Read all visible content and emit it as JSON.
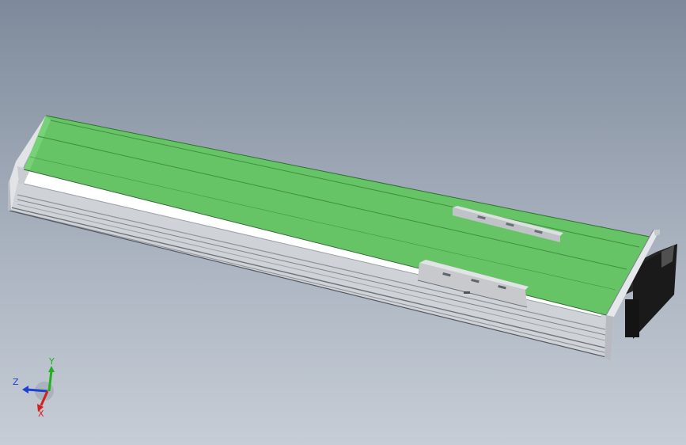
{
  "viewport": {
    "background_top": "#7e8a9b",
    "background_bottom": "#c6cdd6"
  },
  "model": {
    "belt_cover_color": "#66c466",
    "frame_color": "#d4d6da",
    "rail_shadow_color": "#8e939b",
    "motor_color": "#1e1e1e",
    "end_plate_color": "#e6e7ea",
    "carriage_color": "#c7c9cd"
  },
  "triad": {
    "x_label": "X",
    "y_label": "Y",
    "z_label": "Z",
    "x_color": "#d02020",
    "y_color": "#20b020",
    "z_color": "#2040d0"
  }
}
